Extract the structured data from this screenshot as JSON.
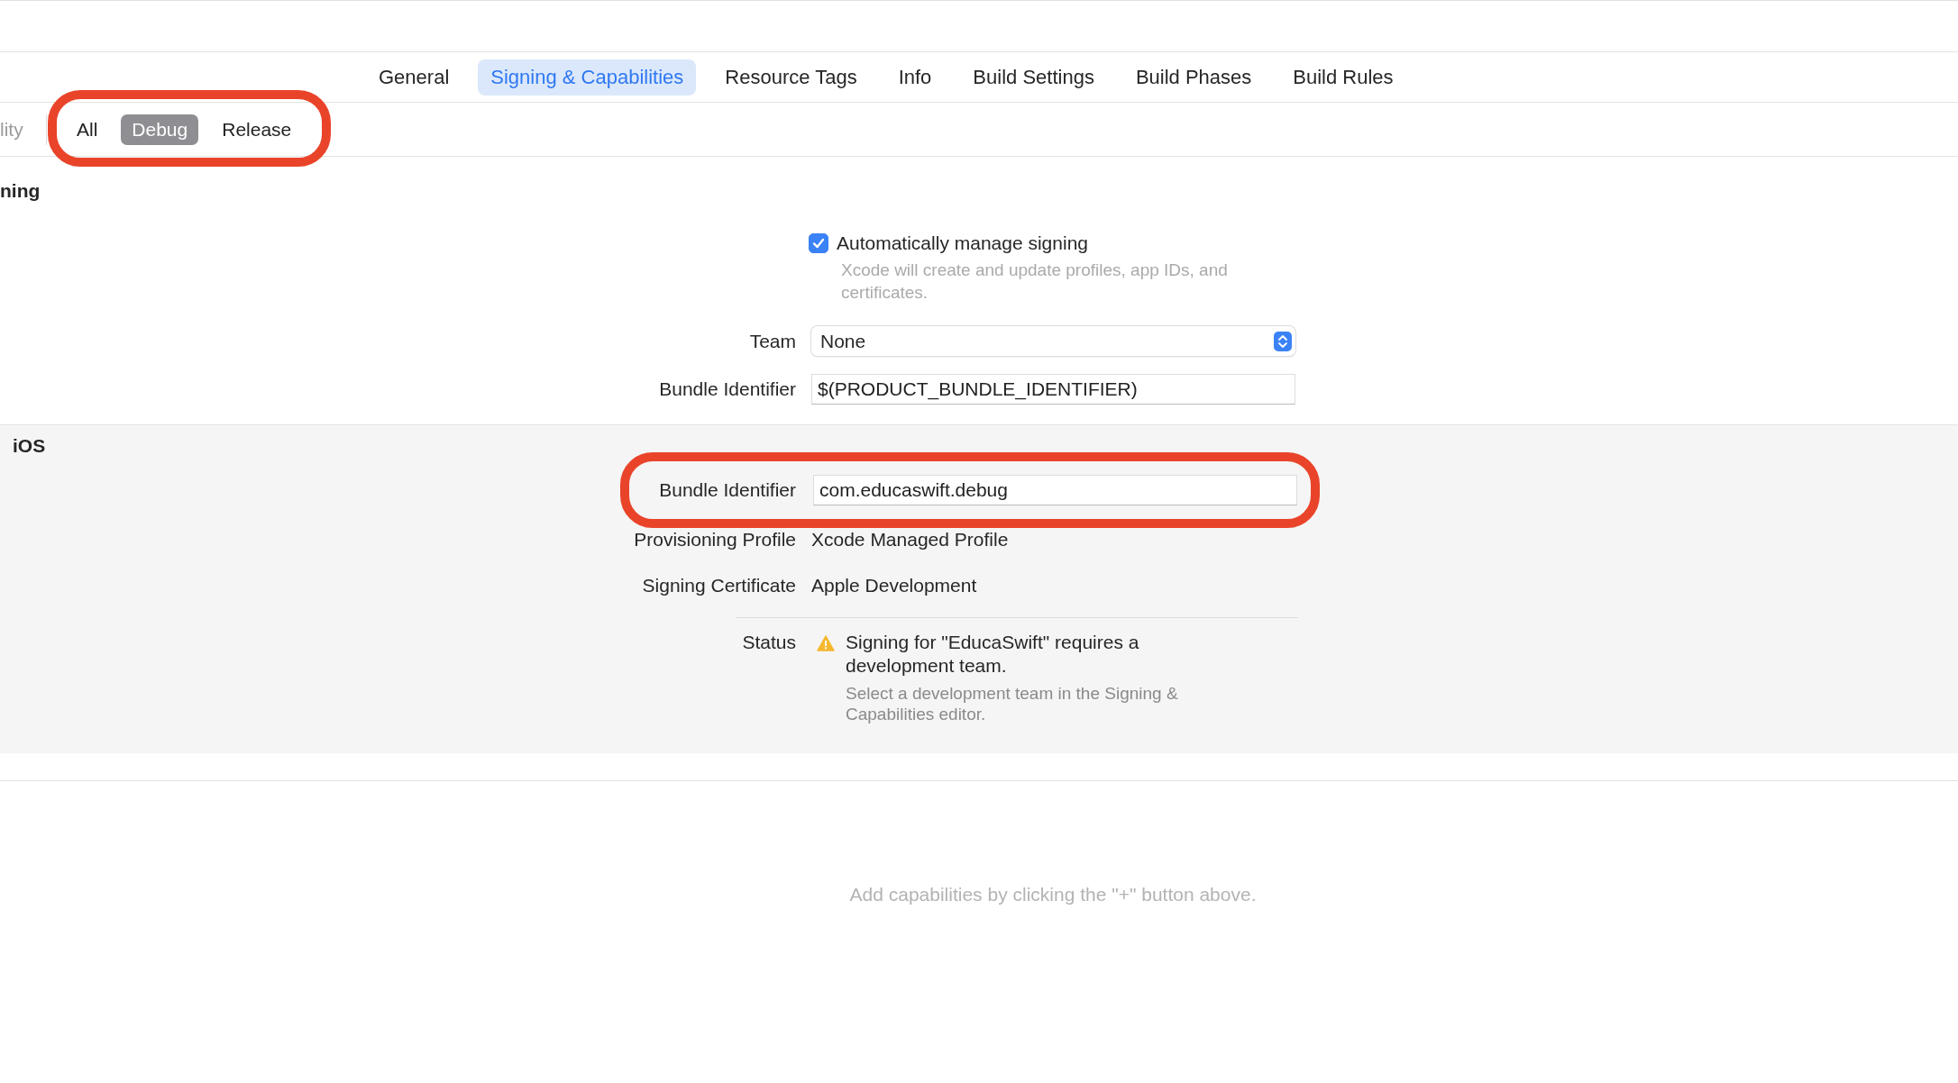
{
  "tabs": [
    {
      "label": "General",
      "selected": false
    },
    {
      "label": "Signing & Capabilities",
      "selected": true
    },
    {
      "label": "Resource Tags",
      "selected": false
    },
    {
      "label": "Info",
      "selected": false
    },
    {
      "label": "Build Settings",
      "selected": false
    },
    {
      "label": "Build Phases",
      "selected": false
    },
    {
      "label": "Build Rules",
      "selected": false
    }
  ],
  "filter_bar": {
    "search_fragment": "lity",
    "highlighted": true,
    "options": [
      {
        "label": "All",
        "selected": false
      },
      {
        "label": "Debug",
        "selected": true
      },
      {
        "label": "Release",
        "selected": false
      }
    ]
  },
  "signing": {
    "title_fragment": "ning",
    "auto_manage": {
      "label": "Automatically manage signing",
      "checked": true,
      "description": "Xcode will create and update profiles, app IDs, and certificates."
    },
    "team": {
      "label": "Team",
      "value": "None"
    },
    "bundle_identifier": {
      "label": "Bundle Identifier",
      "value": "$(PRODUCT_BUNDLE_IDENTIFIER)"
    }
  },
  "ios": {
    "title": "iOS",
    "bundle_identifier": {
      "label": "Bundle Identifier",
      "value": "com.educaswift.debug",
      "highlighted": true
    },
    "provisioning_profile": {
      "label": "Provisioning Profile",
      "value": "Xcode Managed Profile"
    },
    "signing_certificate": {
      "label": "Signing Certificate",
      "value": "Apple Development"
    },
    "status": {
      "label": "Status",
      "message": "Signing for \"EducaSwift\" requires a development team.",
      "detail": "Select a development team in the Signing & Capabilities editor."
    }
  },
  "capabilities_hint": "Add capabilities by clicking the \"+\" button above."
}
